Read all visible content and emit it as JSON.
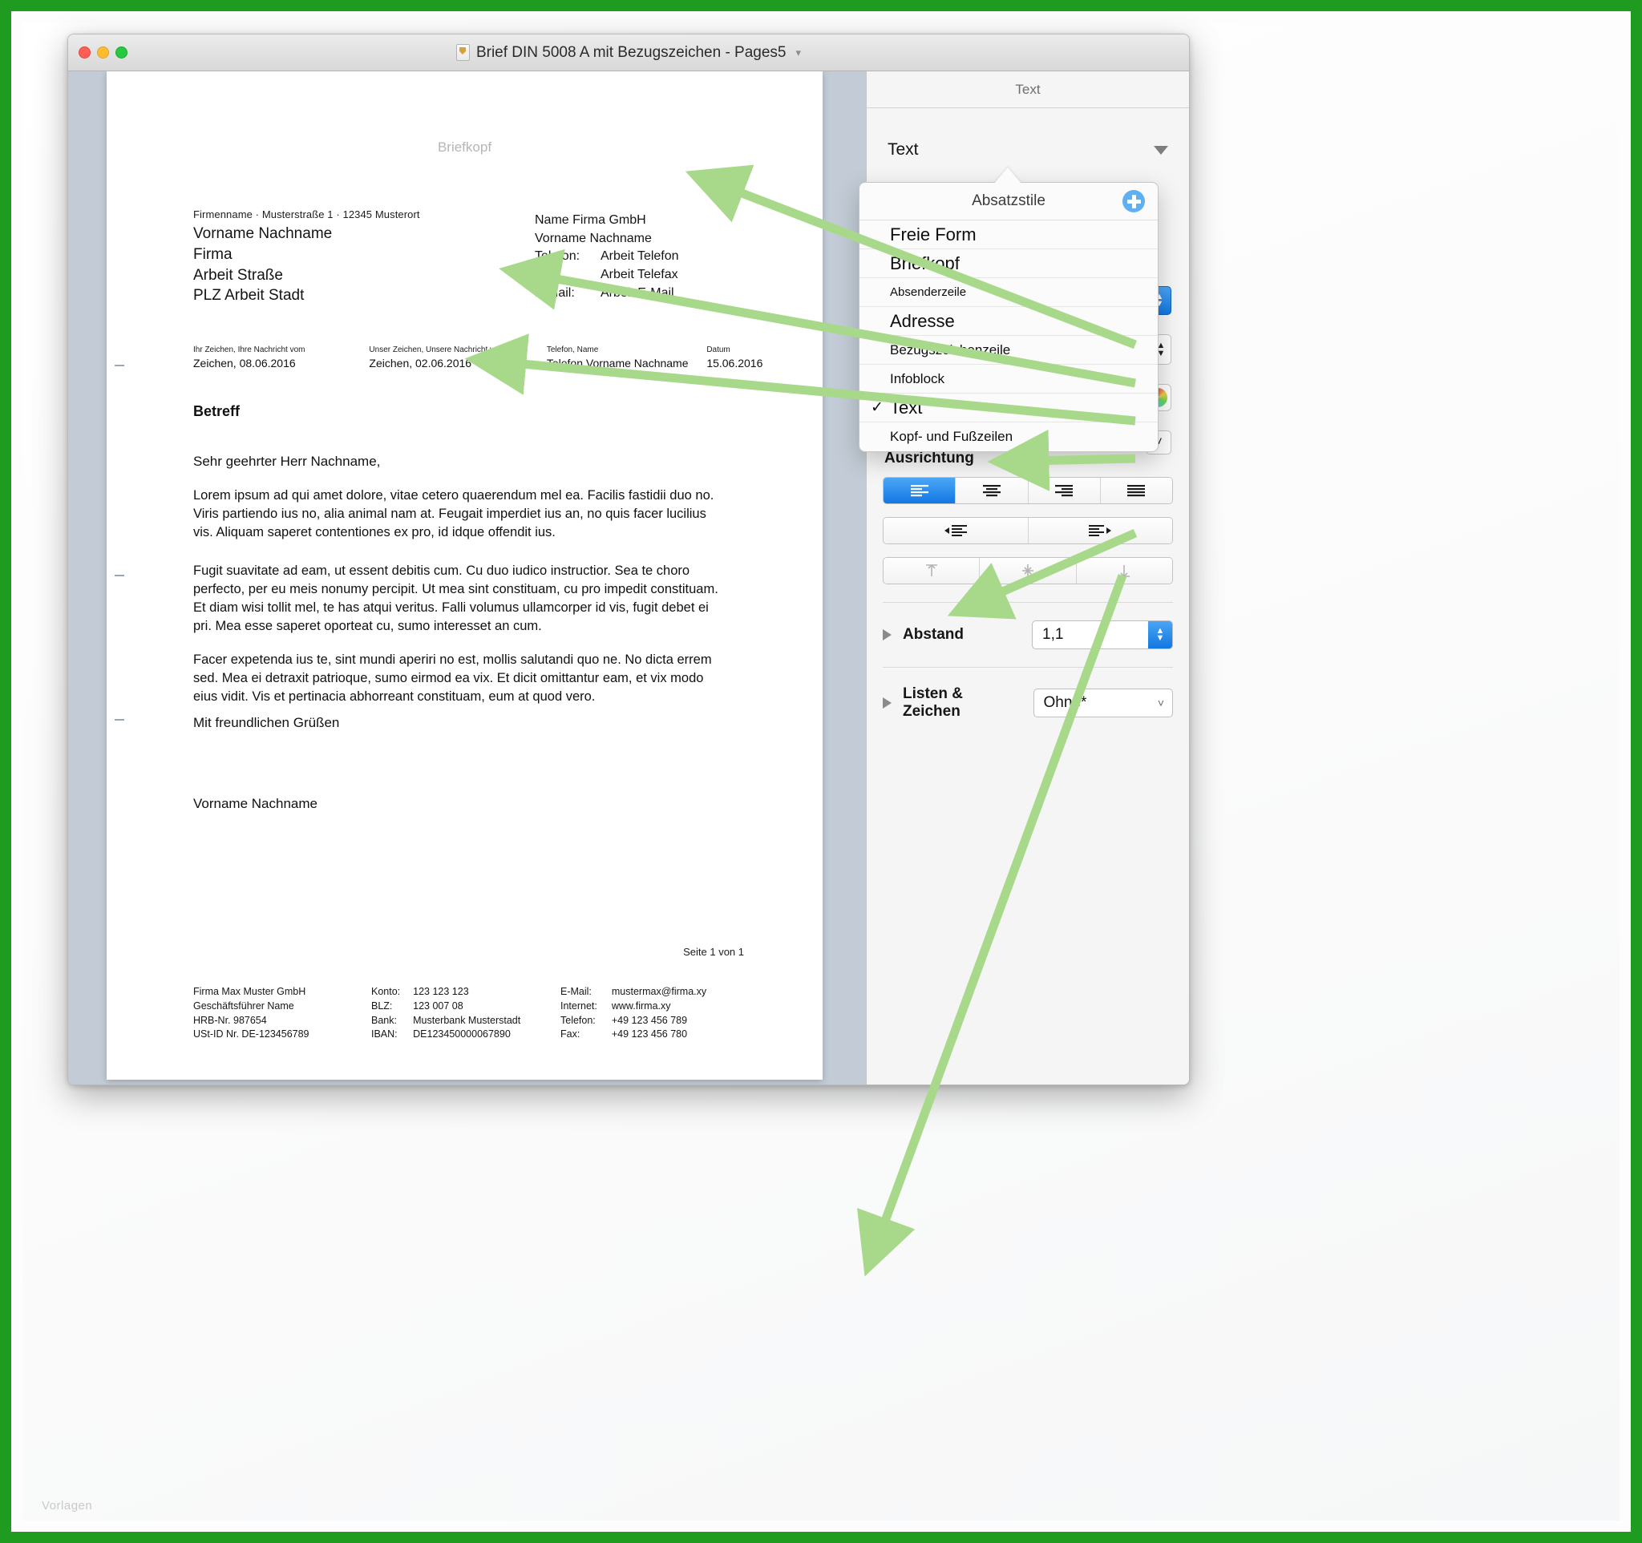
{
  "frame": {
    "watermark": "Vorlagen"
  },
  "window": {
    "title": "Brief DIN 5008 A mit Bezugszeichen - Pages5",
    "title_chevron": "chevron-down",
    "traffic": {
      "close": "close",
      "minimize": "minimize",
      "zoom": "zoom"
    }
  },
  "document": {
    "briefkopf_placeholder": "Briefkopf",
    "sender_line": "Firmenname · Musterstraße 1 · 12345 Musterort",
    "address": [
      "Vorname Nachname",
      "Firma",
      "Arbeit Straße",
      "PLZ Arbeit Stadt"
    ],
    "firm_block": {
      "line1": "Name Firma GmbH",
      "line2": "Vorname Nachname",
      "rows": [
        {
          "key": "Telefon:",
          "value": "Arbeit Telefon"
        },
        {
          "key": "Fax:",
          "value": "Arbeit Telefax"
        },
        {
          "key": "E-Mail:",
          "value": "Arbeit E-Mail"
        }
      ]
    },
    "bezugszeichen": [
      {
        "label": "Ihr Zeichen, Ihre Nachricht vom",
        "value": "Zeichen, 08.06.2016"
      },
      {
        "label": "Unser Zeichen, Unsere Nachricht vom",
        "value": "Zeichen, 02.06.2016"
      },
      {
        "label": "Telefon, Name",
        "value": "Telefon Vorname Nachname"
      },
      {
        "label": "Datum",
        "value": "15.06.2016"
      }
    ],
    "subject": "Betreff",
    "salutation": "Sehr geehrter Herr Nachname,",
    "paragraphs": [
      "Lorem ipsum ad qui amet dolore, vitae cetero quaerendum mel ea. Facilis fastidii duo no. Viris partiendo ius no, alia animal nam at. Feugait imperdiet ius an, no quis facer lucilius vis. Aliquam saperet contentiones ex pro, id idque offendit ius.",
      "Fugit suavitate ad eam, ut essent debitis cum. Cu duo iudico instructior. Sea te choro perfecto, per eu meis nonumy percipit. Ut mea sint constituam, cu pro impedit constituam. Et diam wisi tollit mel, te has atqui veritus. Falli volumus ullamcorper id vis, fugit debet ei pri. Mea esse saperet oporteat cu, sumo interesset an cum.",
      "Facer expetenda ius te, sint mundi aperiri no est, mollis salutandi quo ne. No dicta errem sed. Mea ei detraxit patrioque, sumo eirmod ea vix. Et dicit omittantur eam, et vix modo eius vidit. Vis et pertinacia abhorreant constituam, eum at quod vero."
    ],
    "closing": "Mit freundlichen Grüßen",
    "signature_name": "Vorname Nachname",
    "page_indicator": "Seite 1 von 1",
    "footer": {
      "col1": [
        "Firma Max Muster GmbH",
        "Geschäftsführer Name",
        "HRB-Nr. 987654",
        "USt-ID Nr. DE-123456789"
      ],
      "col2": [
        {
          "key": "Konto:",
          "value": "123 123 123"
        },
        {
          "key": "BLZ:",
          "value": "123 007 08"
        },
        {
          "key": "Bank:",
          "value": "Musterbank Musterstadt"
        },
        {
          "key": "IBAN:",
          "value": "DE123450000067890"
        }
      ],
      "col3": [
        {
          "key": "E-Mail:",
          "value": "mustermax@firma.xy"
        },
        {
          "key": "Internet:",
          "value": "www.firma.xy"
        },
        {
          "key": "Telefon:",
          "value": "+49 123 456 789"
        },
        {
          "key": "Fax:",
          "value": "+49 123 456 780"
        }
      ]
    }
  },
  "inspector": {
    "header_title": "Text",
    "style_popup_value": "Text",
    "alignment": {
      "title": "Ausrichtung",
      "options": [
        "align-left",
        "align-center",
        "align-right",
        "align-justify"
      ],
      "active_index": 0,
      "indent": [
        "decrease-indent",
        "increase-indent"
      ],
      "vertical": [
        "align-top",
        "align-middle",
        "align-bottom"
      ]
    },
    "spacing": {
      "label": "Abstand",
      "value": "1,1"
    },
    "lists": {
      "label": "Listen & Zeichen",
      "value": "Ohne*"
    }
  },
  "popover": {
    "title": "Absatzstile",
    "add_button": "add-style",
    "items": [
      {
        "label": "Freie Form",
        "size": "lg",
        "checked": false
      },
      {
        "label": "Briefkopf",
        "size": "lg",
        "checked": false
      },
      {
        "label": "Absenderzeile",
        "size": "sm",
        "checked": false
      },
      {
        "label": "Adresse",
        "size": "lg",
        "checked": false
      },
      {
        "label": "Bezugszeichenzeile",
        "size": "md",
        "checked": false
      },
      {
        "label": "Infoblock",
        "size": "md",
        "checked": false
      },
      {
        "label": "Text",
        "size": "lg",
        "checked": true
      },
      {
        "label": "Kopf- und Fußzeilen",
        "size": "md",
        "checked": false
      }
    ]
  },
  "annotations": {
    "arrow_color": "#a8d98a",
    "arrows": [
      {
        "from": "Briefkopf-menu-item",
        "to": "document-briefkopf-placeholder"
      },
      {
        "from": "Absenderzeile-menu-item",
        "to": "document-sender-line"
      },
      {
        "from": "Adresse-menu-item",
        "to": "document-address-block"
      },
      {
        "from": "Bezugszeichenzeile-menu-item",
        "to": "document-bezugszeichen-row"
      },
      {
        "from": "Text-menu-item",
        "to": "document-body-text"
      },
      {
        "from": "Kopf-und-Fusszeilen-menu-item",
        "to": "document-page-indicator"
      }
    ]
  }
}
